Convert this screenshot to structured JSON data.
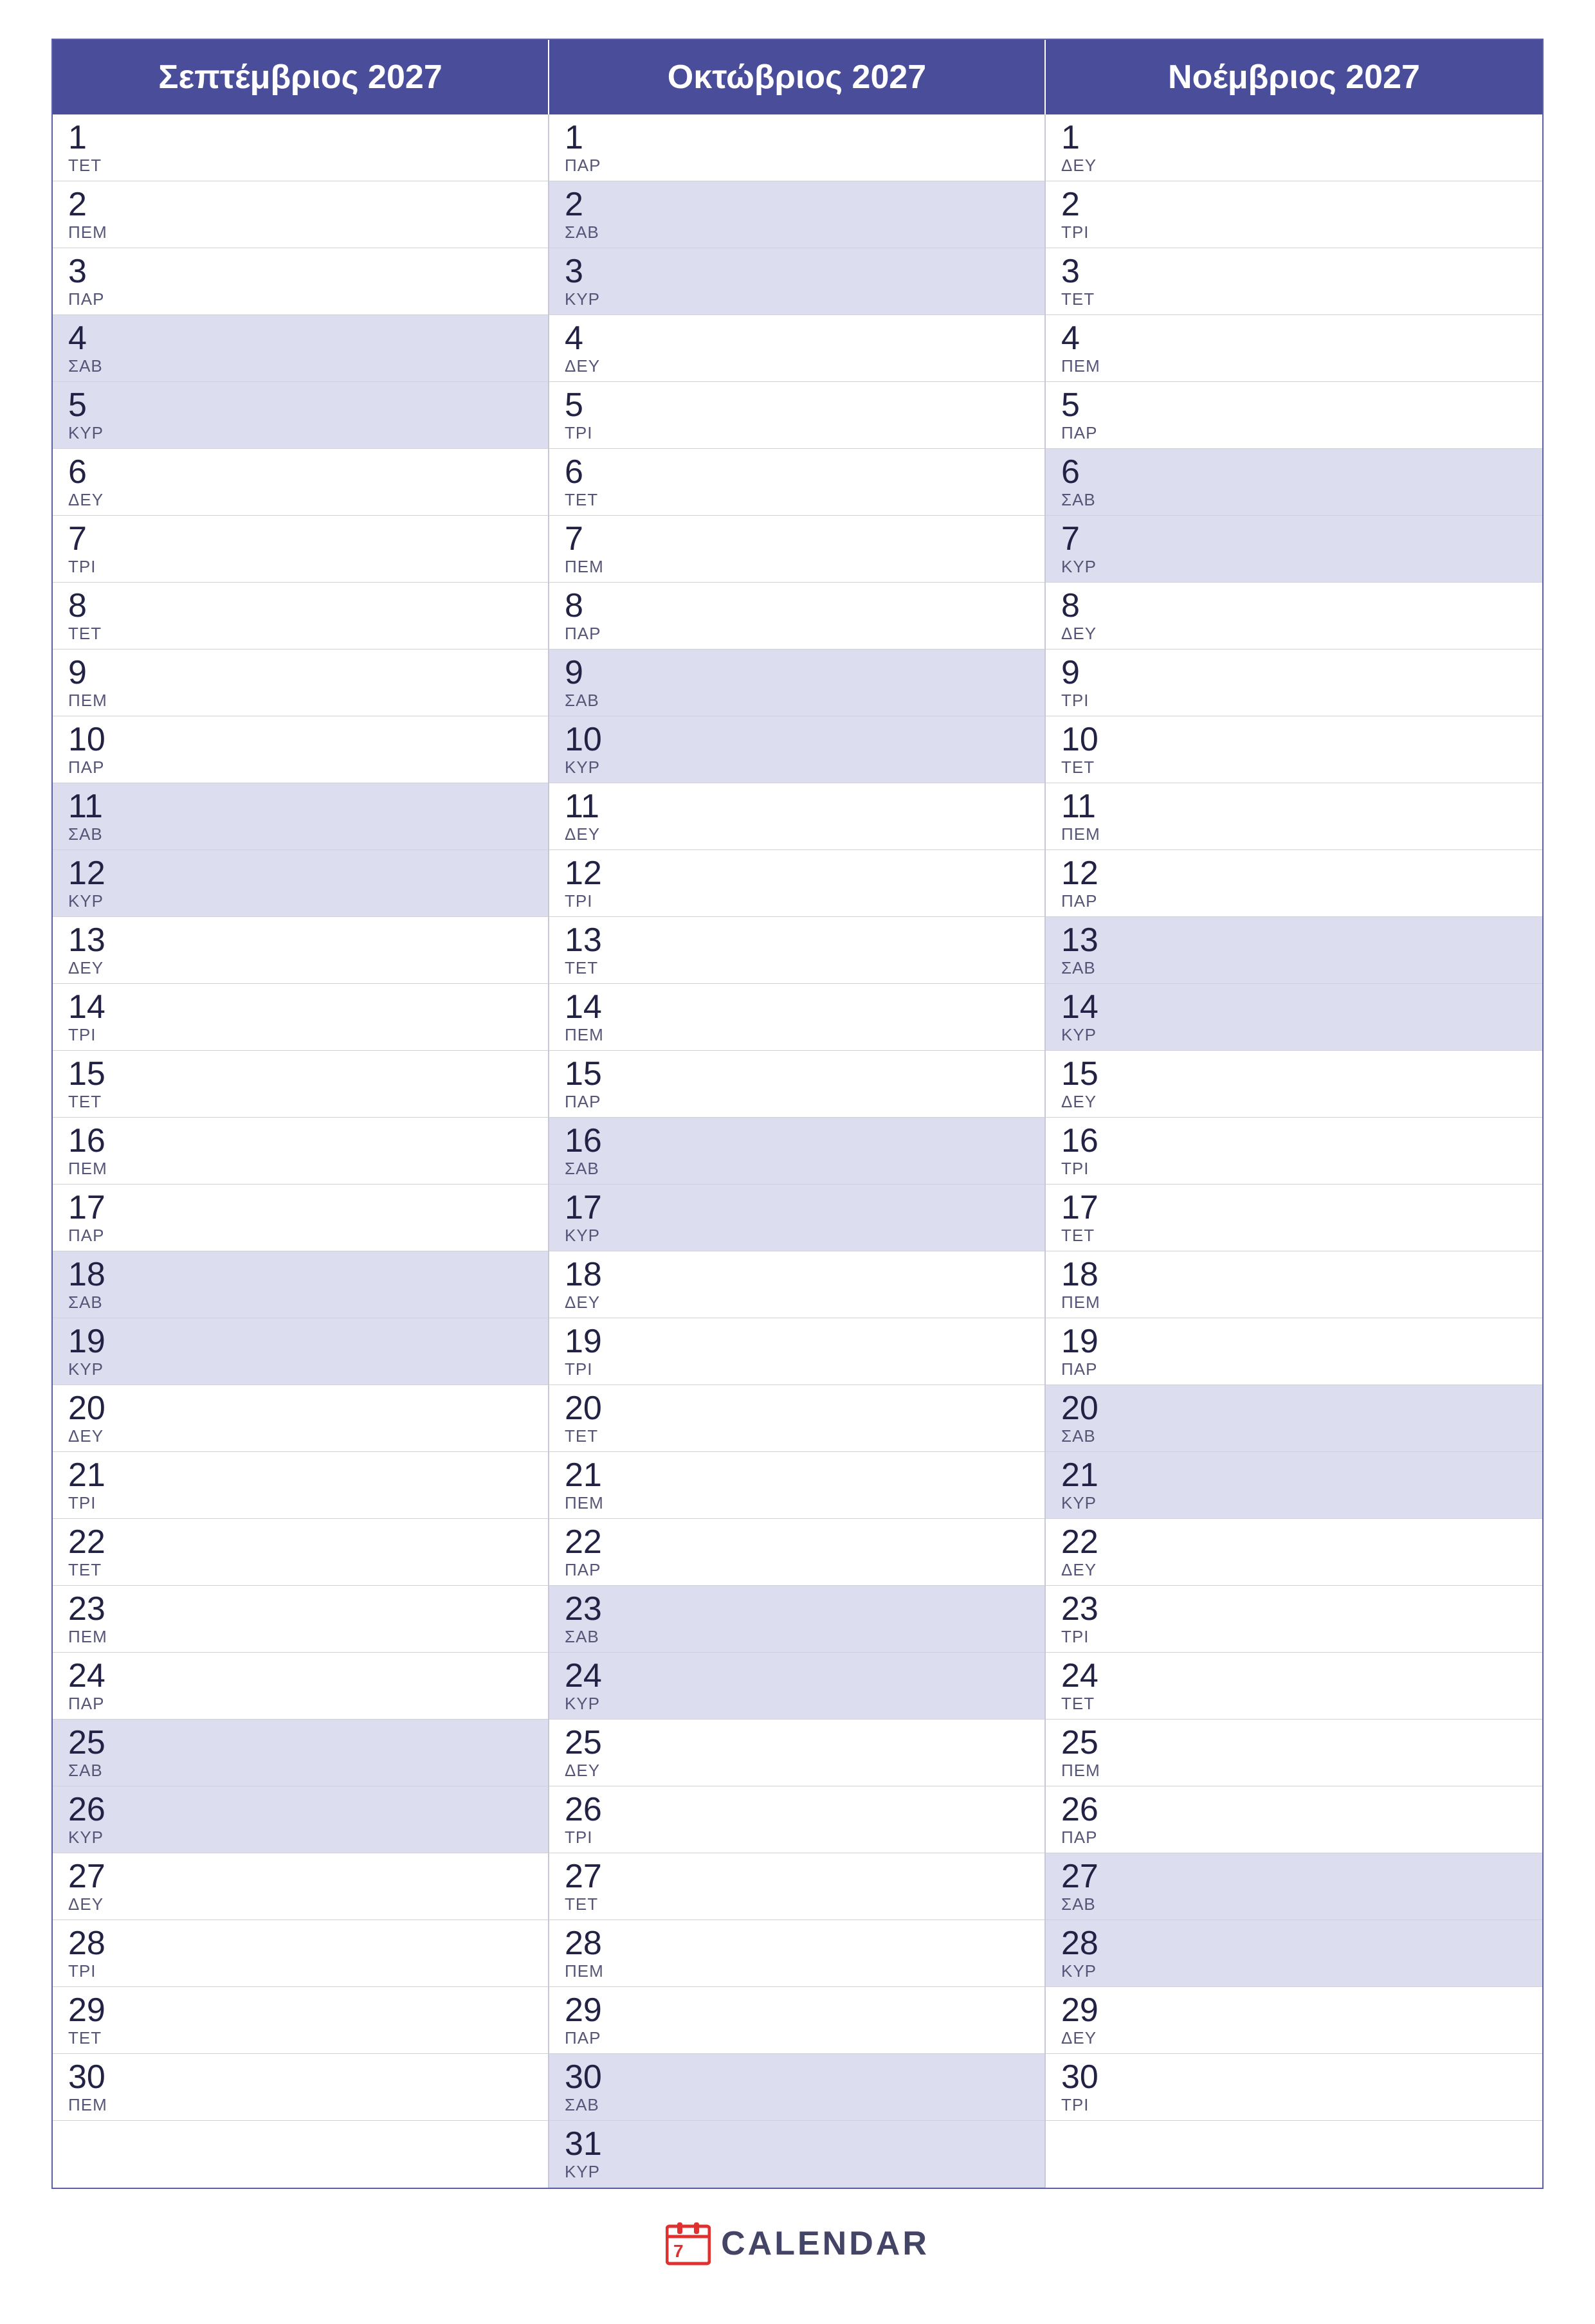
{
  "months": [
    {
      "name": "Σεπτέμβριος 2027",
      "days": [
        {
          "num": "1",
          "abbr": "ΤΕΤ",
          "highlight": false
        },
        {
          "num": "2",
          "abbr": "ΠΕΜ",
          "highlight": false
        },
        {
          "num": "3",
          "abbr": "ΠΑΡ",
          "highlight": false
        },
        {
          "num": "4",
          "abbr": "ΣΑΒ",
          "highlight": true
        },
        {
          "num": "5",
          "abbr": "ΚΥΡ",
          "highlight": true
        },
        {
          "num": "6",
          "abbr": "ΔΕΥ",
          "highlight": false
        },
        {
          "num": "7",
          "abbr": "ΤΡΙ",
          "highlight": false
        },
        {
          "num": "8",
          "abbr": "ΤΕΤ",
          "highlight": false
        },
        {
          "num": "9",
          "abbr": "ΠΕΜ",
          "highlight": false
        },
        {
          "num": "10",
          "abbr": "ΠΑΡ",
          "highlight": false
        },
        {
          "num": "11",
          "abbr": "ΣΑΒ",
          "highlight": true
        },
        {
          "num": "12",
          "abbr": "ΚΥΡ",
          "highlight": true
        },
        {
          "num": "13",
          "abbr": "ΔΕΥ",
          "highlight": false
        },
        {
          "num": "14",
          "abbr": "ΤΡΙ",
          "highlight": false
        },
        {
          "num": "15",
          "abbr": "ΤΕΤ",
          "highlight": false
        },
        {
          "num": "16",
          "abbr": "ΠΕΜ",
          "highlight": false
        },
        {
          "num": "17",
          "abbr": "ΠΑΡ",
          "highlight": false
        },
        {
          "num": "18",
          "abbr": "ΣΑΒ",
          "highlight": true
        },
        {
          "num": "19",
          "abbr": "ΚΥΡ",
          "highlight": true
        },
        {
          "num": "20",
          "abbr": "ΔΕΥ",
          "highlight": false
        },
        {
          "num": "21",
          "abbr": "ΤΡΙ",
          "highlight": false
        },
        {
          "num": "22",
          "abbr": "ΤΕΤ",
          "highlight": false
        },
        {
          "num": "23",
          "abbr": "ΠΕΜ",
          "highlight": false
        },
        {
          "num": "24",
          "abbr": "ΠΑΡ",
          "highlight": false
        },
        {
          "num": "25",
          "abbr": "ΣΑΒ",
          "highlight": true
        },
        {
          "num": "26",
          "abbr": "ΚΥΡ",
          "highlight": true
        },
        {
          "num": "27",
          "abbr": "ΔΕΥ",
          "highlight": false
        },
        {
          "num": "28",
          "abbr": "ΤΡΙ",
          "highlight": false
        },
        {
          "num": "29",
          "abbr": "ΤΕΤ",
          "highlight": false
        },
        {
          "num": "30",
          "abbr": "ΠΕΜ",
          "highlight": false
        }
      ]
    },
    {
      "name": "Οκτώβριος 2027",
      "days": [
        {
          "num": "1",
          "abbr": "ΠΑΡ",
          "highlight": false
        },
        {
          "num": "2",
          "abbr": "ΣΑΒ",
          "highlight": true
        },
        {
          "num": "3",
          "abbr": "ΚΥΡ",
          "highlight": true
        },
        {
          "num": "4",
          "abbr": "ΔΕΥ",
          "highlight": false
        },
        {
          "num": "5",
          "abbr": "ΤΡΙ",
          "highlight": false
        },
        {
          "num": "6",
          "abbr": "ΤΕΤ",
          "highlight": false
        },
        {
          "num": "7",
          "abbr": "ΠΕΜ",
          "highlight": false
        },
        {
          "num": "8",
          "abbr": "ΠΑΡ",
          "highlight": false
        },
        {
          "num": "9",
          "abbr": "ΣΑΒ",
          "highlight": true
        },
        {
          "num": "10",
          "abbr": "ΚΥΡ",
          "highlight": true
        },
        {
          "num": "11",
          "abbr": "ΔΕΥ",
          "highlight": false
        },
        {
          "num": "12",
          "abbr": "ΤΡΙ",
          "highlight": false
        },
        {
          "num": "13",
          "abbr": "ΤΕΤ",
          "highlight": false
        },
        {
          "num": "14",
          "abbr": "ΠΕΜ",
          "highlight": false
        },
        {
          "num": "15",
          "abbr": "ΠΑΡ",
          "highlight": false
        },
        {
          "num": "16",
          "abbr": "ΣΑΒ",
          "highlight": true
        },
        {
          "num": "17",
          "abbr": "ΚΥΡ",
          "highlight": true
        },
        {
          "num": "18",
          "abbr": "ΔΕΥ",
          "highlight": false
        },
        {
          "num": "19",
          "abbr": "ΤΡΙ",
          "highlight": false
        },
        {
          "num": "20",
          "abbr": "ΤΕΤ",
          "highlight": false
        },
        {
          "num": "21",
          "abbr": "ΠΕΜ",
          "highlight": false
        },
        {
          "num": "22",
          "abbr": "ΠΑΡ",
          "highlight": false
        },
        {
          "num": "23",
          "abbr": "ΣΑΒ",
          "highlight": true
        },
        {
          "num": "24",
          "abbr": "ΚΥΡ",
          "highlight": true
        },
        {
          "num": "25",
          "abbr": "ΔΕΥ",
          "highlight": false
        },
        {
          "num": "26",
          "abbr": "ΤΡΙ",
          "highlight": false
        },
        {
          "num": "27",
          "abbr": "ΤΕΤ",
          "highlight": false
        },
        {
          "num": "28",
          "abbr": "ΠΕΜ",
          "highlight": false
        },
        {
          "num": "29",
          "abbr": "ΠΑΡ",
          "highlight": false
        },
        {
          "num": "30",
          "abbr": "ΣΑΒ",
          "highlight": true
        },
        {
          "num": "31",
          "abbr": "ΚΥΡ",
          "highlight": true
        }
      ]
    },
    {
      "name": "Νοέμβριος 2027",
      "days": [
        {
          "num": "1",
          "abbr": "ΔΕΥ",
          "highlight": false
        },
        {
          "num": "2",
          "abbr": "ΤΡΙ",
          "highlight": false
        },
        {
          "num": "3",
          "abbr": "ΤΕΤ",
          "highlight": false
        },
        {
          "num": "4",
          "abbr": "ΠΕΜ",
          "highlight": false
        },
        {
          "num": "5",
          "abbr": "ΠΑΡ",
          "highlight": false
        },
        {
          "num": "6",
          "abbr": "ΣΑΒ",
          "highlight": true
        },
        {
          "num": "7",
          "abbr": "ΚΥΡ",
          "highlight": true
        },
        {
          "num": "8",
          "abbr": "ΔΕΥ",
          "highlight": false
        },
        {
          "num": "9",
          "abbr": "ΤΡΙ",
          "highlight": false
        },
        {
          "num": "10",
          "abbr": "ΤΕΤ",
          "highlight": false
        },
        {
          "num": "11",
          "abbr": "ΠΕΜ",
          "highlight": false
        },
        {
          "num": "12",
          "abbr": "ΠΑΡ",
          "highlight": false
        },
        {
          "num": "13",
          "abbr": "ΣΑΒ",
          "highlight": true
        },
        {
          "num": "14",
          "abbr": "ΚΥΡ",
          "highlight": true
        },
        {
          "num": "15",
          "abbr": "ΔΕΥ",
          "highlight": false
        },
        {
          "num": "16",
          "abbr": "ΤΡΙ",
          "highlight": false
        },
        {
          "num": "17",
          "abbr": "ΤΕΤ",
          "highlight": false
        },
        {
          "num": "18",
          "abbr": "ΠΕΜ",
          "highlight": false
        },
        {
          "num": "19",
          "abbr": "ΠΑΡ",
          "highlight": false
        },
        {
          "num": "20",
          "abbr": "ΣΑΒ",
          "highlight": true
        },
        {
          "num": "21",
          "abbr": "ΚΥΡ",
          "highlight": true
        },
        {
          "num": "22",
          "abbr": "ΔΕΥ",
          "highlight": false
        },
        {
          "num": "23",
          "abbr": "ΤΡΙ",
          "highlight": false
        },
        {
          "num": "24",
          "abbr": "ΤΕΤ",
          "highlight": false
        },
        {
          "num": "25",
          "abbr": "ΠΕΜ",
          "highlight": false
        },
        {
          "num": "26",
          "abbr": "ΠΑΡ",
          "highlight": false
        },
        {
          "num": "27",
          "abbr": "ΣΑΒ",
          "highlight": true
        },
        {
          "num": "28",
          "abbr": "ΚΥΡ",
          "highlight": true
        },
        {
          "num": "29",
          "abbr": "ΔΕΥ",
          "highlight": false
        },
        {
          "num": "30",
          "abbr": "ΤΡΙ",
          "highlight": false
        }
      ]
    }
  ],
  "footer": {
    "logo_text": "CALENDAR",
    "accent_color": "#e03030"
  }
}
